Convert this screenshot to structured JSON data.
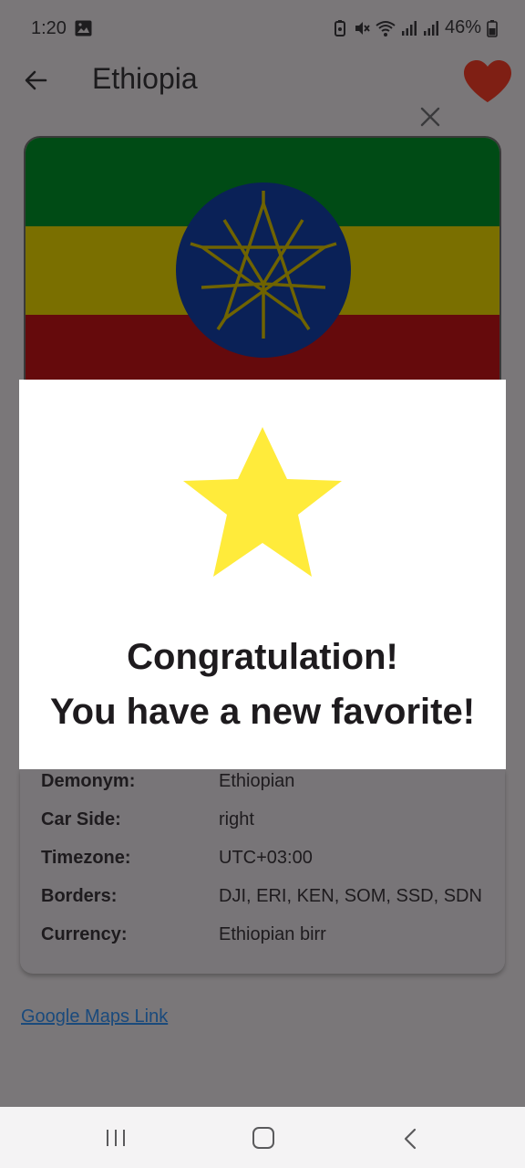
{
  "status_bar": {
    "time": "1:20",
    "battery_percent": "46%",
    "icons": [
      "image-icon",
      "battery-saver-icon",
      "mute-icon",
      "wifi-icon",
      "signal-icon",
      "signal-icon",
      "battery-icon"
    ]
  },
  "app_bar": {
    "title": "Ethiopia",
    "back_icon": "arrow-left-icon",
    "favorite_icon": "heart-icon",
    "favorite_color": "#7f1f14"
  },
  "flag": {
    "country": "Ethiopia",
    "colors": {
      "green": "#004b15",
      "yellow": "#7a6f00",
      "red": "#650a0c",
      "emblem_blue": "#0a2157",
      "emblem_star": "#6f6300"
    }
  },
  "dialog": {
    "icon": "star-icon",
    "star_color": "#ffeb3b",
    "line1": "Congratulation!",
    "line2": "You have a new favorite!",
    "close_icon": "close-icon"
  },
  "details": {
    "rows": [
      {
        "label": "Demonym:",
        "value": "Ethiopian"
      },
      {
        "label": "Car Side:",
        "value": "right"
      },
      {
        "label": "Timezone:",
        "value": "UTC+03:00"
      },
      {
        "label": "Borders:",
        "value": "DJI, ERI, KEN, SOM, SSD, SDN"
      },
      {
        "label": "Currency:",
        "value": "Ethiopian birr"
      }
    ]
  },
  "maps_link": {
    "label": "Google Maps Link"
  },
  "nav_bar": {
    "icons": [
      "recents-icon",
      "home-icon",
      "back-icon"
    ]
  }
}
